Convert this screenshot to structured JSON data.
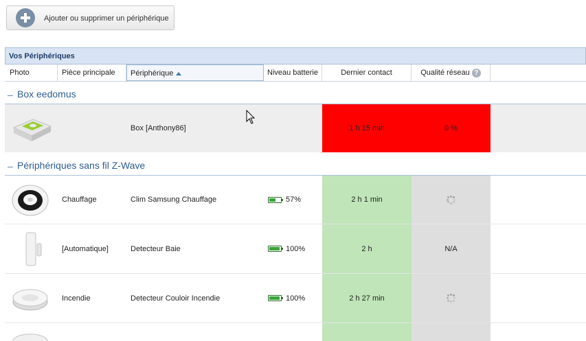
{
  "toolbar": {
    "add_label": "Ajouter ou supprimer un périphérique"
  },
  "panel": {
    "title": "Vos Périphériques"
  },
  "columns": {
    "photo": "Photo",
    "room": "Pièce principale",
    "device": "Périphérique",
    "battery": "Niveau batterie",
    "last_contact": "Dernier contact",
    "network": "Qualité réseau"
  },
  "groups": [
    {
      "title": "Box eedomus",
      "rows": [
        {
          "room": "",
          "device": "Box [Anthony86]",
          "battery": "",
          "last_contact": "1 h 15 min",
          "network": "0 %",
          "status_color": "#ff0000"
        }
      ]
    },
    {
      "title": "Périphériques sans fil Z-Wave",
      "rows": [
        {
          "room": "Chauffage",
          "device": "Clim Samsung Chauffage",
          "battery": "57%",
          "battery_level": 0.57,
          "last_contact": "2 h 1 min",
          "network": "",
          "network_icon": "loading-spinner-icon"
        },
        {
          "room": "[Automatique]",
          "device": "Detecteur Baie",
          "battery": "100%",
          "battery_level": 1.0,
          "last_contact": "2 h",
          "network": "N/A"
        },
        {
          "room": "Incendie",
          "device": "Detecteur Couloir Incendie",
          "battery": "100%",
          "battery_level": 1.0,
          "last_contact": "2 h 27 min",
          "network": "",
          "network_icon": "loading-spinner-icon"
        }
      ]
    }
  ],
  "colors": {
    "alert": "#ff0000",
    "ok": "#bfe5b8",
    "neutral": "#dedede",
    "header_bg": "#d8e4f3"
  }
}
